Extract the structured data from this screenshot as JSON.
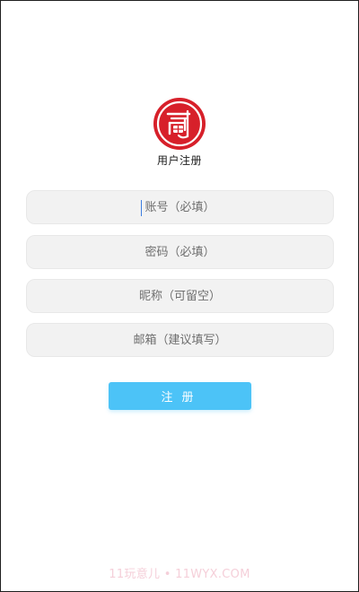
{
  "brand": {
    "title": "用户注册",
    "logo_icon": "app-logo-icon",
    "logo_color": "#d7202a"
  },
  "form": {
    "account_placeholder": "账号（必填）",
    "password_placeholder": "密码（必填）",
    "nickname_placeholder": "昵称（可留空）",
    "email_placeholder": "邮箱（建议填写）",
    "account_value": "",
    "password_value": "",
    "nickname_value": "",
    "email_value": ""
  },
  "actions": {
    "register_label": "注册",
    "register_color": "#4cc3f7"
  },
  "watermark": "11玩意儿 • 11WYX.COM"
}
